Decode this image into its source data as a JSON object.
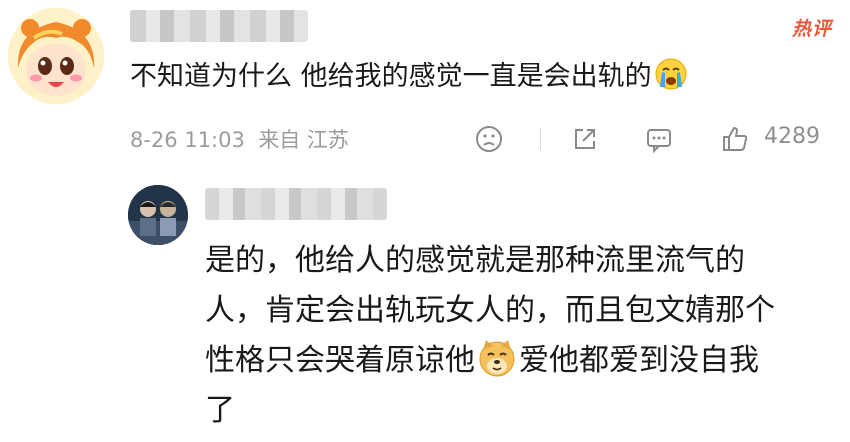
{
  "comment": {
    "text": "不知道为什么 他给我的感觉一直是会出轨的",
    "badge": "热评",
    "date": "8-26 11:03",
    "source": "来自 江苏",
    "likes": "4289",
    "emoji": "crying-face"
  },
  "reply": {
    "line1": "是的，他给人的感觉就是那种流里流气的",
    "line2": "人，肯定会出轨玩女人的，而且包文婧那个",
    "line3a": "性格只会哭着原谅他",
    "line3b": "爱他都爱到没自我",
    "line4": "了",
    "emoji": "doge"
  },
  "colors": {
    "hot_badge": "#ec5a3c",
    "meta_gray": "#9c9c9c",
    "text": "#1a1a1a"
  }
}
